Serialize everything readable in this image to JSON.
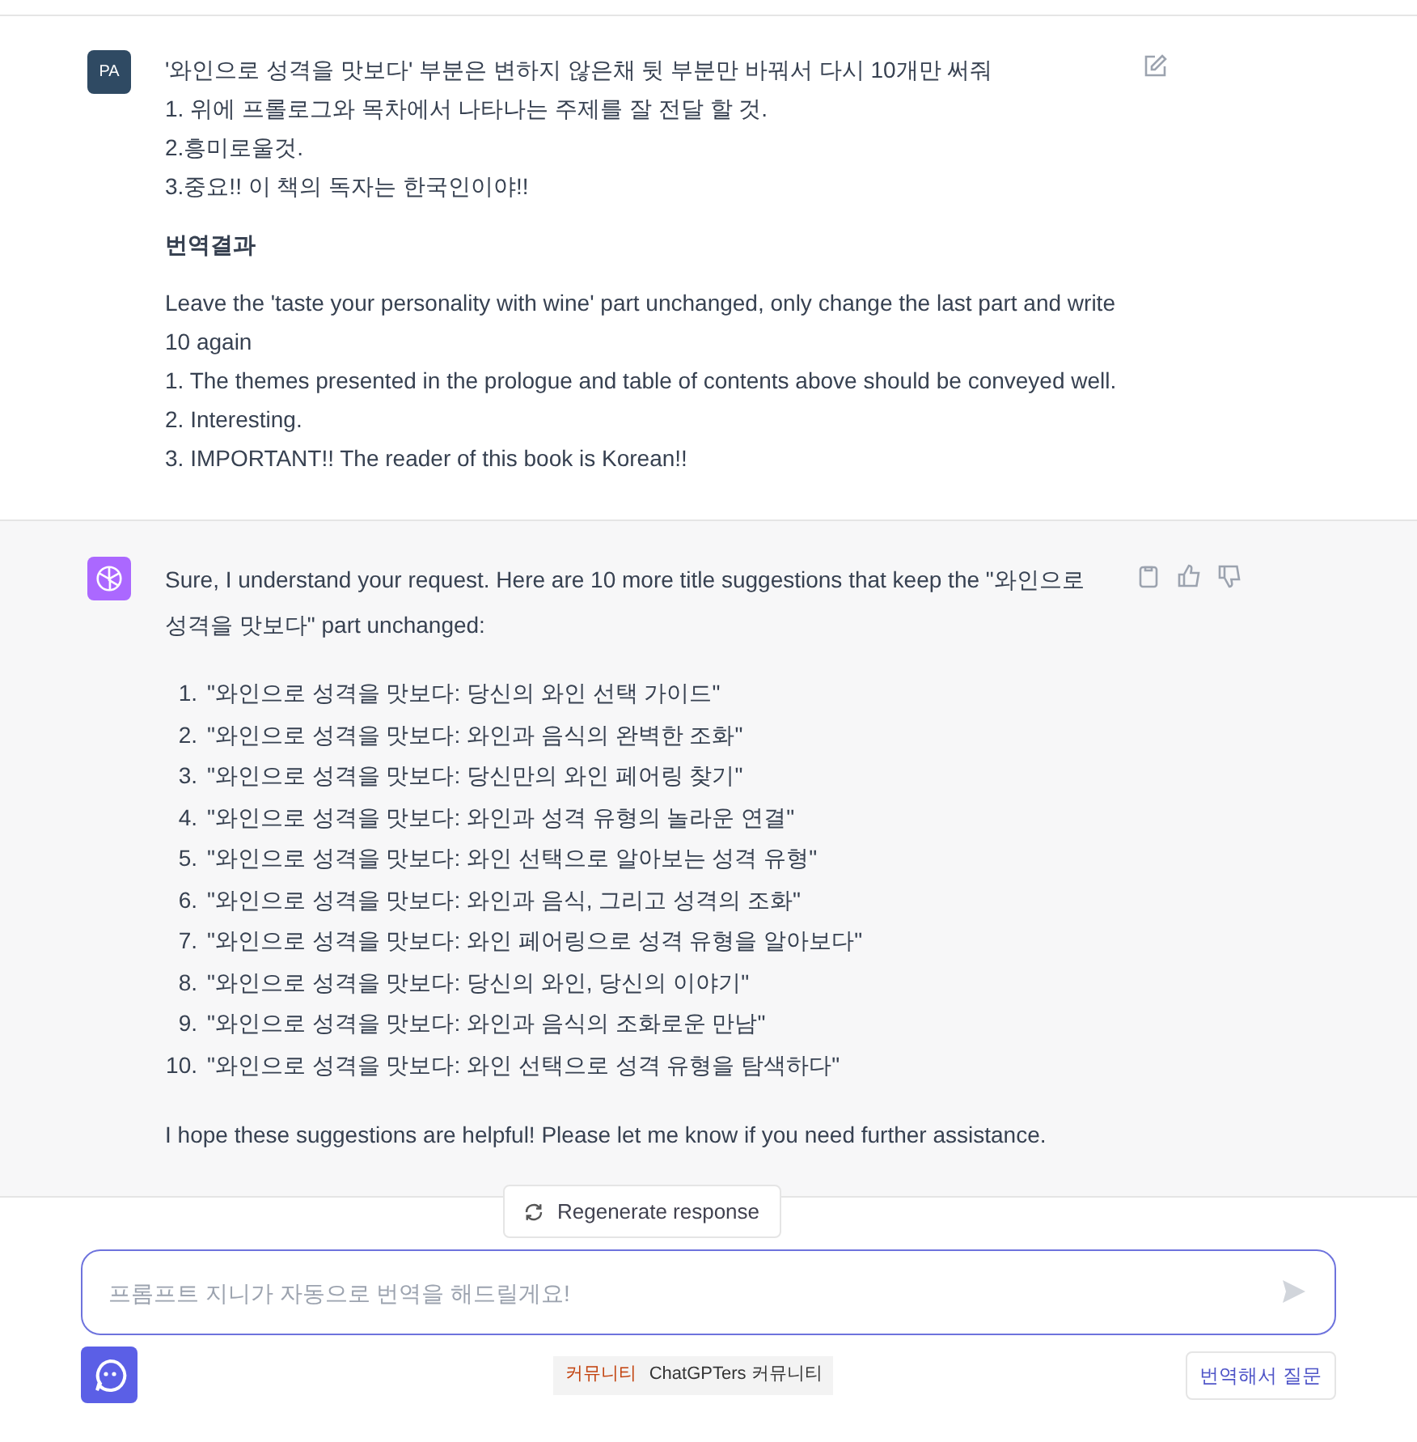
{
  "messages": [
    {
      "kind": "user",
      "avatar": "PA",
      "lines": [
        "'와인으로 성격을 맛보다' 부분은 변하지 않은채 뒷 부분만 바꿔서 다시 10개만 써줘",
        "1. 위에 프롤로그와 목차에서 나타나는 주제를 잘 전달 할 것.",
        "2.흥미로울것.",
        "3.중요!! 이 책의 독자는 한국인이야!!"
      ],
      "translation": {
        "heading": "번역결과",
        "lines": [
          "Leave the 'taste your personality with wine' part unchanged, only change the last part and write 10 again",
          "1. The themes presented in the prologue and table of contents above should be conveyed well.",
          "2. Interesting.",
          "3. IMPORTANT!! The reader of this book is Korean!!"
        ]
      }
    },
    {
      "kind": "assistant",
      "intro": "Sure, I understand your request. Here are 10 more title suggestions that keep the \"와인으로 성격을 맛보다\" part unchanged:",
      "items": [
        {
          "number": "1.",
          "text": "\"와인으로 성격을 맛보다: 당신의 와인 선택 가이드\""
        },
        {
          "number": "2.",
          "text": "\"와인으로 성격을 맛보다: 와인과 음식의 완벽한 조화\""
        },
        {
          "number": "3.",
          "text": "\"와인으로 성격을 맛보다: 당신만의 와인 페어링 찾기\""
        },
        {
          "number": "4.",
          "text": "\"와인으로 성격을 맛보다: 와인과 성격 유형의 놀라운 연결\""
        },
        {
          "number": "5.",
          "text": "\"와인으로 성격을 맛보다: 와인 선택으로 알아보는 성격 유형\""
        },
        {
          "number": "6.",
          "text": "\"와인으로 성격을 맛보다: 와인과 음식, 그리고 성격의 조화\""
        },
        {
          "number": "7.",
          "text": "\"와인으로 성격을 맛보다: 와인 페어링으로 성격 유형을 알아보다\""
        },
        {
          "number": "8.",
          "text": "\"와인으로 성격을 맛보다: 당신의 와인, 당신의 이야기\""
        },
        {
          "number": "9.",
          "text": "\"와인으로 성격을 맛보다: 와인과 음식의 조화로운 만남\""
        },
        {
          "number": "10.",
          "text": "\"와인으로 성격을 맛보다: 와인 선택으로 성격 유형을 탐색하다\""
        }
      ],
      "closing": "I hope these suggestions are helpful! Please let me know if you need further assistance."
    }
  ],
  "regenerate_button": "Regenerate response",
  "prompt": {
    "placeholder": "프롬프트 지니가 자동으로 번역을 해드릴게요!"
  },
  "community": {
    "tag": "커뮤니티",
    "label": "ChatGPTers 커뮤니티"
  },
  "translate_button": "번역해서 질문"
}
